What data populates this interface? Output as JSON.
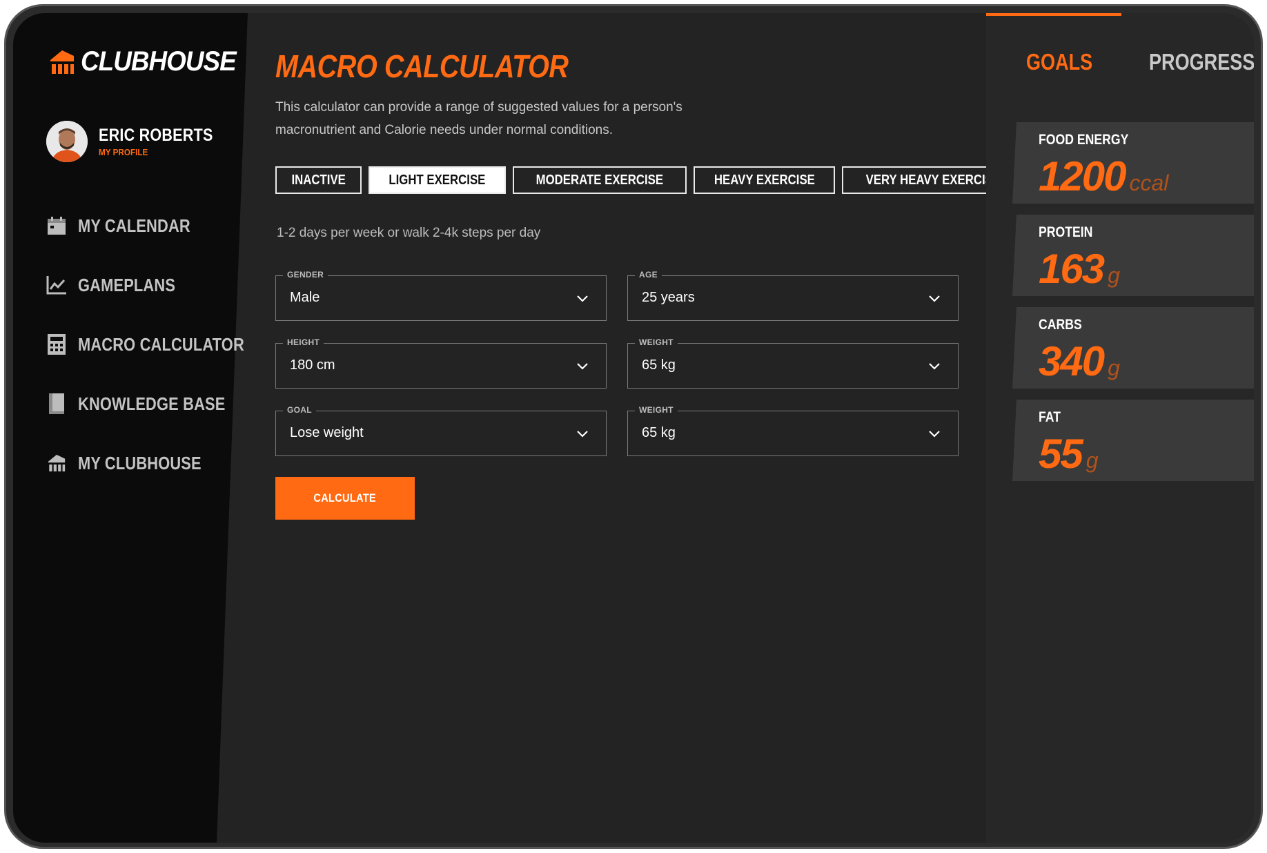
{
  "colors": {
    "accent": "#ff6a13",
    "sidebar": "#0b0b0b",
    "main_bg": "#232323",
    "panel_bg": "#3a3a3a"
  },
  "brand": {
    "name": "CLUBHOUSE",
    "icon": "clubhouse-logo-icon"
  },
  "profile": {
    "name": "ERIC ROBERTS",
    "link": "MY PROFILE"
  },
  "sidebar": {
    "items": [
      {
        "label": "MY CALENDAR",
        "icon": "calendar-icon"
      },
      {
        "label": "GAMEPLANS",
        "icon": "chart-line-icon"
      },
      {
        "label": "MACRO CALCULATOR",
        "icon": "calculator-icon"
      },
      {
        "label": "KNOWLEDGE BASE",
        "icon": "book-icon"
      },
      {
        "label": "MY CLUBHOUSE",
        "icon": "clubhouse-icon"
      }
    ]
  },
  "main": {
    "title": "MACRO CALCULATOR",
    "intro": "This calculator can provide a range of suggested values for a person's macronutrient and Calorie needs under normal conditions.",
    "activity_tabs": [
      "INACTIVE",
      "LIGHT EXERCISE",
      "MODERATE EXERCISE",
      "HEAVY EXERCISE",
      "VERY HEAVY EXERCISE"
    ],
    "active_tab": "LIGHT EXERCISE",
    "activity_description": "1-2 days per week or walk 2-4k steps per day",
    "fields": {
      "gender": {
        "label": "GENDER",
        "value": "Male"
      },
      "age": {
        "label": "AGE",
        "value": "25 years"
      },
      "height": {
        "label": "HEIGHT",
        "value": "180 cm"
      },
      "weight": {
        "label": "WEIGHT",
        "value": "65 kg"
      },
      "goal": {
        "label": "GOAL",
        "value": "Lose weight"
      },
      "weight2": {
        "label": "WEIGHT",
        "value": "65 kg"
      }
    },
    "calculate_label": "CALCULATE"
  },
  "right": {
    "tabs": {
      "goals": "GOALS",
      "progress": "PROGRESS"
    },
    "active_tab": "GOALS",
    "stats": {
      "energy": {
        "label": "FOOD ENERGY",
        "value": "1200",
        "unit": "ccal"
      },
      "protein": {
        "label": "PROTEIN",
        "value": "163",
        "unit": "g"
      },
      "carbs": {
        "label": "CARBS",
        "value": "340",
        "unit": "g"
      },
      "fat": {
        "label": "FAT",
        "value": "55",
        "unit": "g"
      }
    }
  }
}
